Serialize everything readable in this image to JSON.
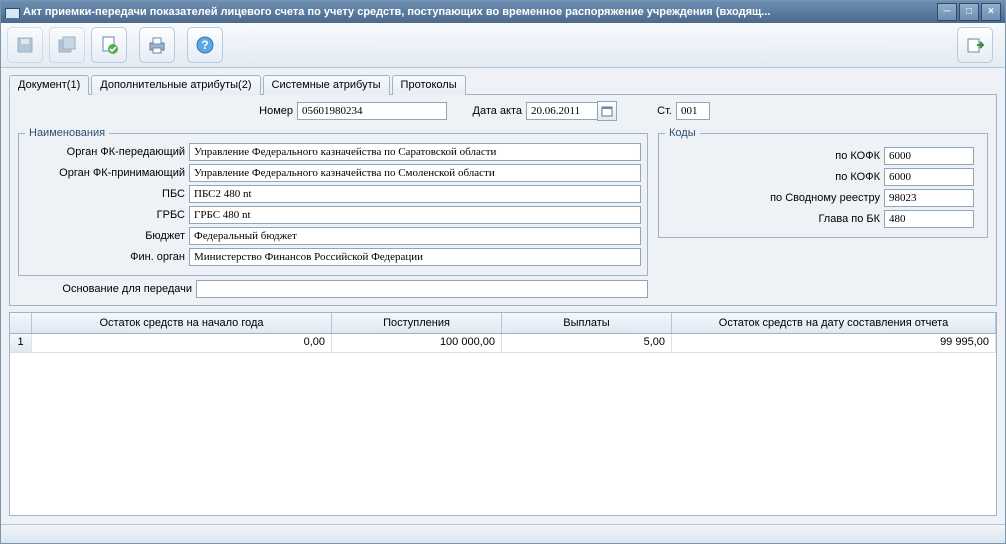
{
  "window": {
    "title": "Акт приемки-передачи показателей лицевого счета по учету средств, поступающих во временное распоряжение учреждения (входящ..."
  },
  "tabs": [
    {
      "label": "Документ(1)"
    },
    {
      "label": "Дополнительные атрибуты(2)"
    },
    {
      "label": "Системные атрибуты"
    },
    {
      "label": "Протоколы"
    }
  ],
  "header": {
    "number_label": "Номер",
    "number_value": "05601980234",
    "date_label": "Дата акта",
    "date_value": "20.06.2011",
    "st_label": "Ст.",
    "st_value": "001"
  },
  "fieldsets": {
    "names_legend": "Наименования",
    "codes_legend": "Коды"
  },
  "names": {
    "fk_send_label": "Орган ФК-передающий",
    "fk_send_value": "Управление Федерального казначейства по Саратовской области",
    "fk_recv_label": "Орган ФК-принимающий",
    "fk_recv_value": "Управление Федерального казначейства по Смоленской области",
    "pbs_label": "ПБС",
    "pbs_value": "ПБС2 480 nt",
    "grbs_label": "ГРБС",
    "grbs_value": "ГРБС 480 nt",
    "budget_label": "Бюджет",
    "budget_value": "Федеральный бюджет",
    "finorg_label": "Фин. орган",
    "finorg_value": "Министерство Финансов Российской Федерации",
    "basis_label": "Основание для передачи",
    "basis_value": ""
  },
  "codes": {
    "kofk1_label": "по КОФК",
    "kofk1_value": "6000",
    "kofk2_label": "по КОФК",
    "kofk2_value": "6000",
    "svod_label": "по Сводному реестру",
    "svod_value": "98023",
    "glava_label": "Глава по БК",
    "glava_value": "480"
  },
  "grid": {
    "columns": [
      "Остаток средств на начало года",
      "Поступления",
      "Выплаты",
      "Остаток средств на дату составления отчета"
    ],
    "rownum": "1",
    "row": [
      "0,00",
      "100 000,00",
      "5,00",
      "99 995,00"
    ]
  }
}
